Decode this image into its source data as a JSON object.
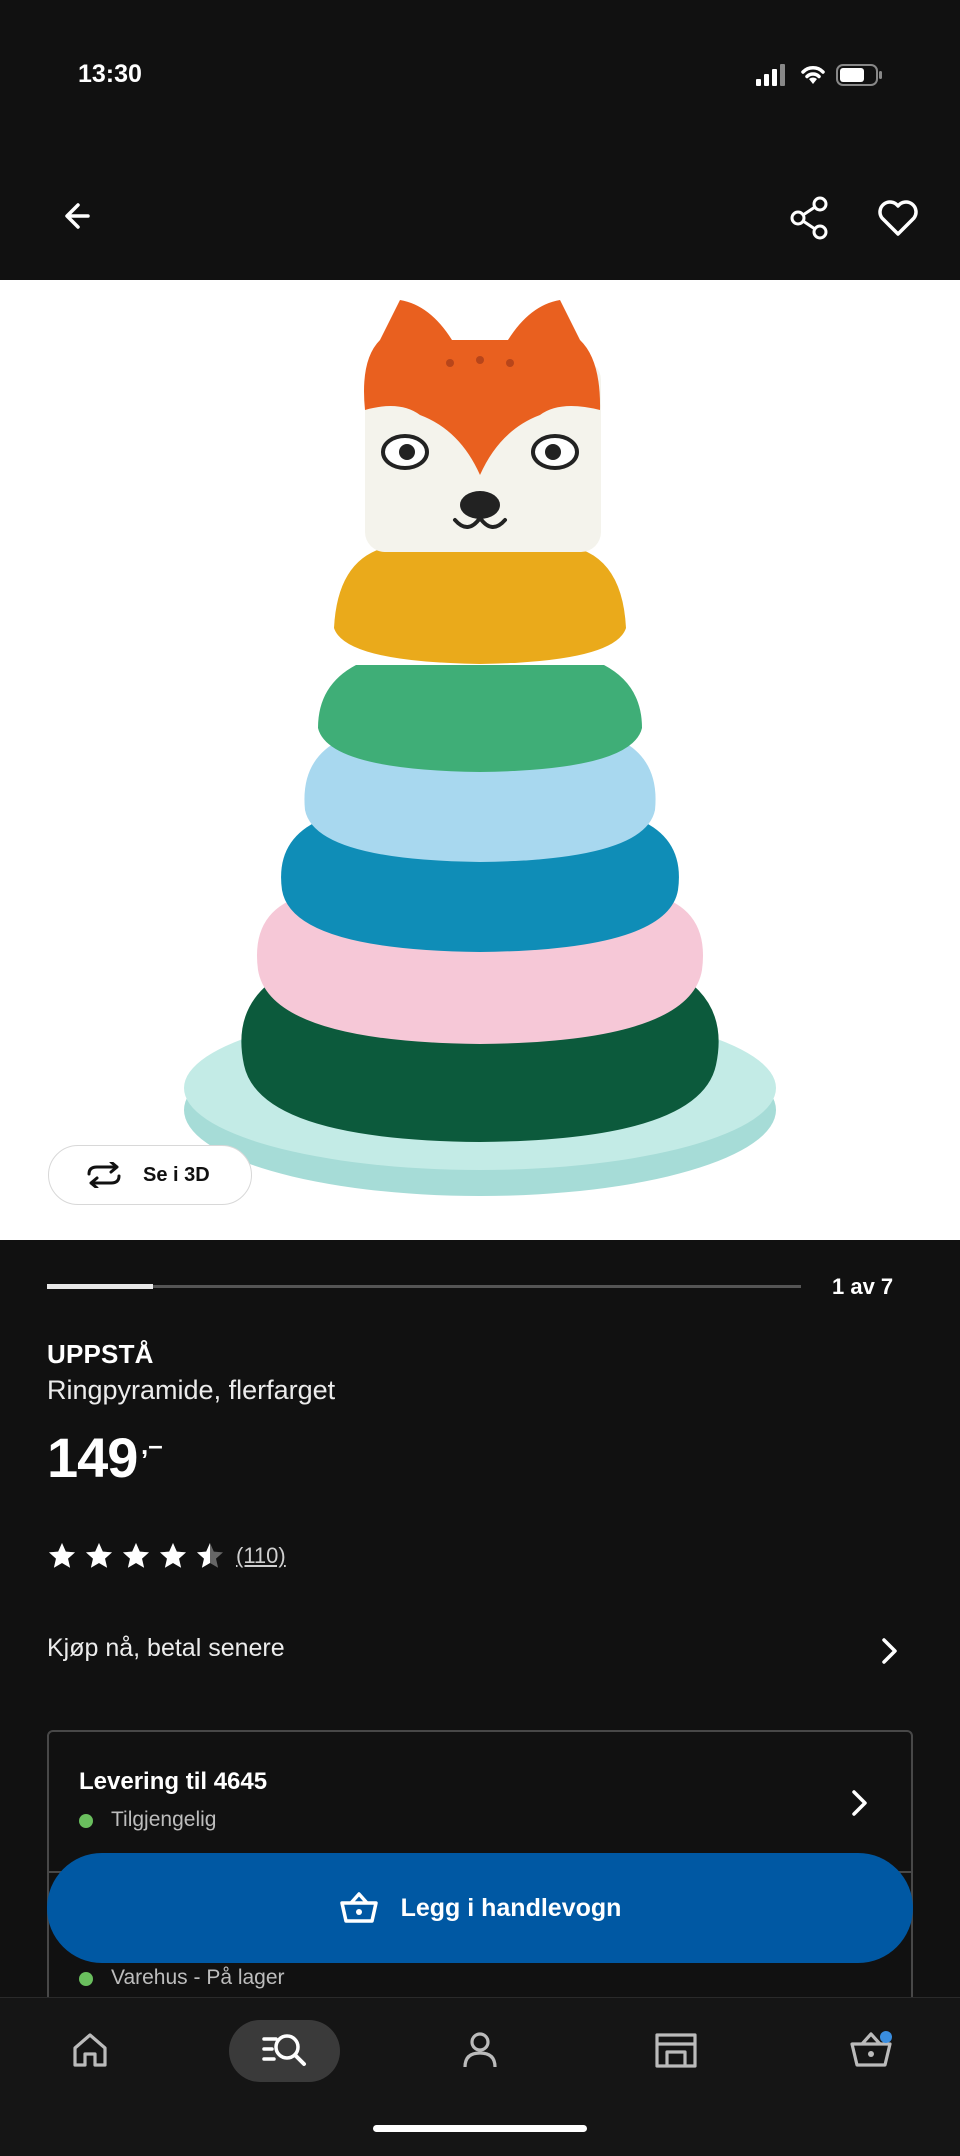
{
  "status_bar": {
    "time": "13:30"
  },
  "header": {
    "back_icon": "arrow-left-icon",
    "share_icon": "share-icon",
    "favorite_icon": "heart-icon"
  },
  "gallery": {
    "view_3d_label": "Se i 3D",
    "counter": "1 av 7",
    "progress": 0.14
  },
  "product": {
    "brand": "UPPSTÅ",
    "description": "Ringpyramide, flerfarget",
    "price": "149",
    "price_suffix": ",–",
    "rating": 4.5,
    "review_count": "(110)"
  },
  "bnpl": {
    "label": "Kjøp nå, betal senere"
  },
  "delivery": {
    "title": "Levering til 4645",
    "status": "Tilgjengelig",
    "store_status": "Varehus - På lager",
    "status_color": "#6abf5e"
  },
  "cart_button": {
    "label": "Legg i handlevogn",
    "color": "#0058a3"
  },
  "nav": {
    "items": [
      "home-icon",
      "search-icon",
      "account-icon",
      "store-icon",
      "cart-icon"
    ],
    "active": "search-icon"
  }
}
